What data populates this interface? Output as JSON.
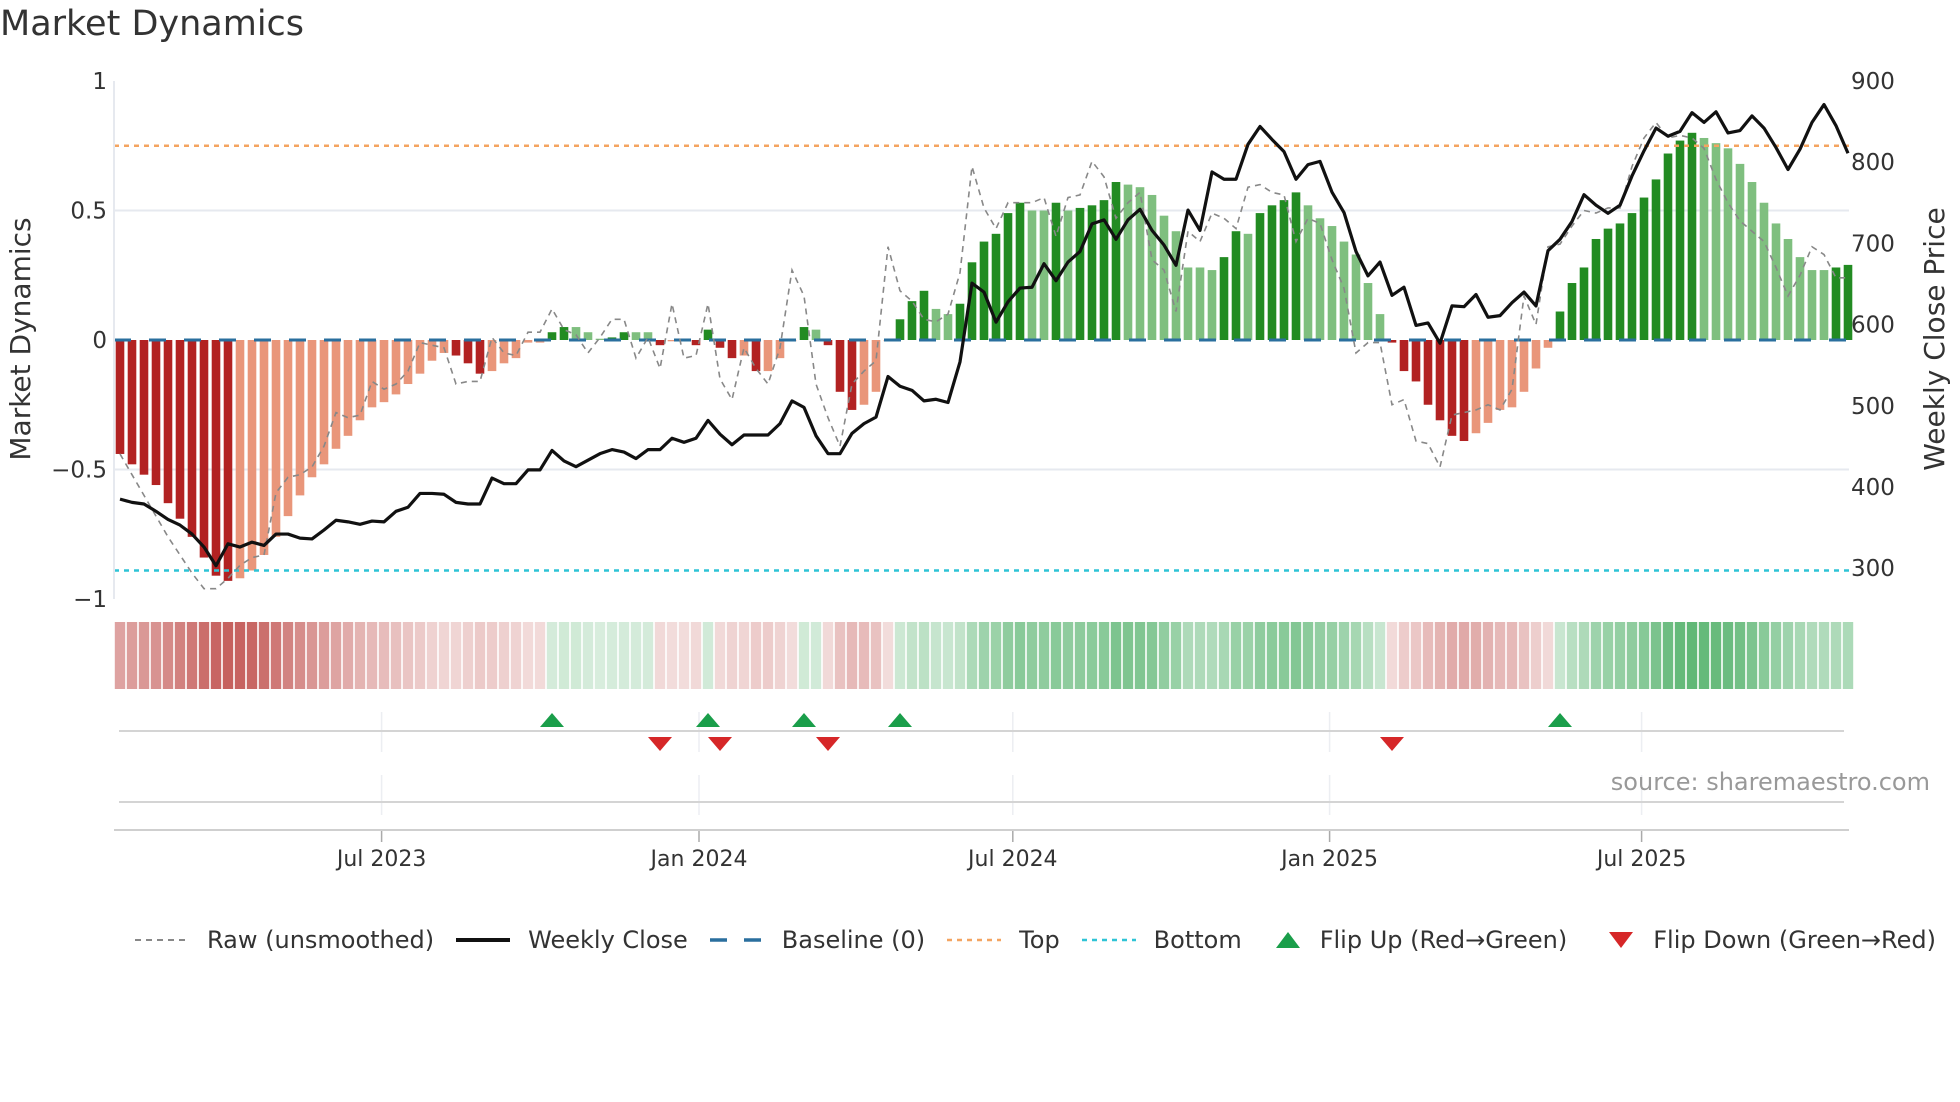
{
  "title": "Market Dynamics",
  "source": "source: sharemaestro.com",
  "chart_data": {
    "type": "bar",
    "title": "Market Dynamics",
    "ylabel": "Market Dynamics",
    "y2label": "Weekly Close Price",
    "ylim": [
      -1,
      1
    ],
    "y2lim": [
      262,
      900
    ],
    "yticks": [
      {
        "v": 1,
        "label": "1"
      },
      {
        "v": 0.5,
        "label": "0.5"
      },
      {
        "v": 0,
        "label": "0"
      },
      {
        "v": -0.5,
        "label": "−0.5"
      },
      {
        "v": -1,
        "label": "−1"
      }
    ],
    "y2ticks": [
      {
        "v": 900,
        "label": "900"
      },
      {
        "v": 800,
        "label": "800"
      },
      {
        "v": 700,
        "label": "700"
      },
      {
        "v": 600,
        "label": "600"
      },
      {
        "v": 500,
        "label": "500"
      },
      {
        "v": 400,
        "label": "400"
      },
      {
        "v": 300,
        "label": "300"
      }
    ],
    "grid_values": [
      0.5,
      -0.5
    ],
    "xticks": [
      {
        "week": 21.8,
        "label": "Jul 2023"
      },
      {
        "week": 48.25,
        "label": "Jan 2024"
      },
      {
        "week": 74.4,
        "label": "Jul 2024"
      },
      {
        "week": 100.8,
        "label": "Jan 2025"
      },
      {
        "week": 126.8,
        "label": "Jul 2025"
      }
    ],
    "reference_lines": {
      "top": 0.75,
      "bottom": -0.89,
      "baseline": 0
    },
    "histogram": [
      -0.44,
      -0.48,
      -0.52,
      -0.56,
      -0.63,
      -0.69,
      -0.76,
      -0.84,
      -0.91,
      -0.93,
      -0.92,
      -0.89,
      -0.83,
      -0.76,
      -0.68,
      -0.6,
      -0.53,
      -0.48,
      -0.42,
      -0.37,
      -0.31,
      -0.26,
      -0.24,
      -0.21,
      -0.17,
      -0.13,
      -0.08,
      -0.05,
      -0.06,
      -0.09,
      -0.13,
      -0.12,
      -0.09,
      -0.07,
      -0.01,
      -0.01,
      0.03,
      0.05,
      0.05,
      0.03,
      0.005,
      0.01,
      0.03,
      0.03,
      0.03,
      -0.02,
      -0.005,
      -0.005,
      -0.02,
      0.04,
      -0.03,
      -0.07,
      -0.06,
      -0.12,
      -0.12,
      -0.07,
      -0.005,
      0.05,
      0.04,
      -0.02,
      -0.2,
      -0.27,
      -0.25,
      -0.2,
      -0.005,
      0.08,
      0.15,
      0.19,
      0.12,
      0.1,
      0.14,
      0.3,
      0.38,
      0.41,
      0.49,
      0.53,
      0.5,
      0.5,
      0.53,
      0.5,
      0.51,
      0.52,
      0.54,
      0.61,
      0.6,
      0.59,
      0.56,
      0.48,
      0.42,
      0.28,
      0.28,
      0.27,
      0.32,
      0.42,
      0.41,
      0.49,
      0.52,
      0.54,
      0.57,
      0.52,
      0.47,
      0.44,
      0.38,
      0.33,
      0.22,
      0.1,
      -0.01,
      -0.12,
      -0.16,
      -0.25,
      -0.31,
      -0.37,
      -0.39,
      -0.36,
      -0.32,
      -0.27,
      -0.26,
      -0.2,
      -0.11,
      -0.03,
      0.11,
      0.22,
      0.28,
      0.39,
      0.43,
      0.45,
      0.49,
      0.55,
      0.62,
      0.72,
      0.77,
      0.8,
      0.78,
      0.76,
      0.74,
      0.68,
      0.61,
      0.53,
      0.45,
      0.39,
      0.32,
      0.27,
      0.27,
      0.28,
      0.29
    ],
    "raw": [
      -0.44,
      -0.52,
      -0.6,
      -0.68,
      -0.76,
      -0.83,
      -0.9,
      -0.96,
      -0.96,
      -0.92,
      -0.87,
      -0.84,
      -0.83,
      -0.59,
      -0.53,
      -0.52,
      -0.49,
      -0.41,
      -0.28,
      -0.3,
      -0.29,
      -0.16,
      -0.19,
      -0.17,
      -0.12,
      -0.01,
      -0.02,
      -0.03,
      -0.17,
      -0.16,
      -0.16,
      0.01,
      -0.05,
      -0.06,
      0.03,
      0.03,
      0.12,
      0.04,
      0.02,
      -0.05,
      0.01,
      0.08,
      0.08,
      -0.07,
      0.01,
      -0.11,
      0.14,
      -0.07,
      -0.06,
      0.14,
      -0.15,
      -0.23,
      -0.03,
      -0.11,
      -0.17,
      -0.03,
      0.27,
      0.17,
      -0.17,
      -0.3,
      -0.41,
      -0.17,
      -0.12,
      -0.08,
      0.36,
      0.19,
      0.15,
      0.08,
      0.07,
      0.1,
      0.26,
      0.67,
      0.51,
      0.43,
      0.53,
      0.53,
      0.53,
      0.55,
      0.4,
      0.55,
      0.56,
      0.69,
      0.63,
      0.47,
      0.53,
      0.57,
      0.31,
      0.27,
      0.11,
      0.42,
      0.38,
      0.49,
      0.47,
      0.43,
      0.59,
      0.6,
      0.57,
      0.56,
      0.38,
      0.47,
      0.45,
      0.31,
      0.2,
      -0.05,
      -0.01,
      -0.01,
      -0.25,
      -0.23,
      -0.39,
      -0.4,
      -0.49,
      -0.29,
      -0.28,
      -0.27,
      -0.25,
      -0.27,
      -0.19,
      0.17,
      0.06,
      0.36,
      0.37,
      0.44,
      0.5,
      0.49,
      0.51,
      0.51,
      0.67,
      0.78,
      0.84,
      0.78,
      0.79,
      0.78,
      0.74,
      0.62,
      0.53,
      0.46,
      0.42,
      0.38,
      0.28,
      0.17,
      0.25,
      0.36,
      0.33,
      0.24,
      0.24
    ],
    "close": [
      385,
      381,
      379,
      370,
      360,
      353,
      342,
      326,
      303,
      330,
      326,
      332,
      328,
      342,
      342,
      337,
      336,
      347,
      359,
      357,
      354,
      358,
      357,
      370,
      375,
      392,
      392,
      391,
      381,
      379,
      379,
      411,
      404,
      404,
      421,
      421,
      445,
      432,
      425,
      433,
      441,
      446,
      443,
      435,
      446,
      446,
      460,
      455,
      460,
      482,
      465,
      452,
      464,
      464,
      464,
      478,
      506,
      498,
      463,
      441,
      441,
      466,
      478,
      486,
      536,
      524,
      519,
      506,
      508,
      504,
      554,
      651,
      640,
      603,
      628,
      645,
      646,
      675,
      654,
      677,
      690,
      724,
      729,
      705,
      729,
      742,
      716,
      698,
      673,
      741,
      716,
      788,
      779,
      779,
      822,
      844,
      828,
      813,
      779,
      797,
      801,
      763,
      738,
      690,
      660,
      677,
      636,
      646,
      599,
      602,
      577,
      623,
      622,
      637,
      609,
      611,
      627,
      640,
      623,
      691,
      705,
      727,
      760,
      747,
      737,
      747,
      783,
      814,
      842,
      832,
      838,
      861,
      849,
      862,
      836,
      839,
      857,
      842,
      818,
      791,
      816,
      849,
      871,
      845,
      811
    ],
    "flips_up": [
      36,
      49,
      57,
      65,
      120
    ],
    "flips_down": [
      45,
      50,
      59,
      106
    ],
    "legend": {
      "position": "bottom",
      "items": [
        {
          "key": "raw",
          "label": "Raw (unsmoothed)"
        },
        {
          "key": "close",
          "label": "Weekly Close"
        },
        {
          "key": "baseline",
          "label": "Baseline (0)"
        },
        {
          "key": "top",
          "label": "Top"
        },
        {
          "key": "bottom",
          "label": "Bottom"
        },
        {
          "key": "up",
          "label": "Flip Up (Red→Green)"
        },
        {
          "key": "down",
          "label": "Flip Down (Green→Red)"
        }
      ]
    }
  },
  "colors": {
    "red_strong": "#b22222",
    "red_weak": "#e9967a",
    "green_strong": "#228b22",
    "green_weak": "#7fbf7f",
    "strip_red": "#c0504d",
    "strip_green": "#3aa655",
    "raw": "#888888",
    "close": "#111111",
    "baseline": "#2a6f9e",
    "top": "#f4a460",
    "bottom": "#2ec4d6",
    "flip_up": "#1a9e4a",
    "flip_down": "#d62728"
  }
}
